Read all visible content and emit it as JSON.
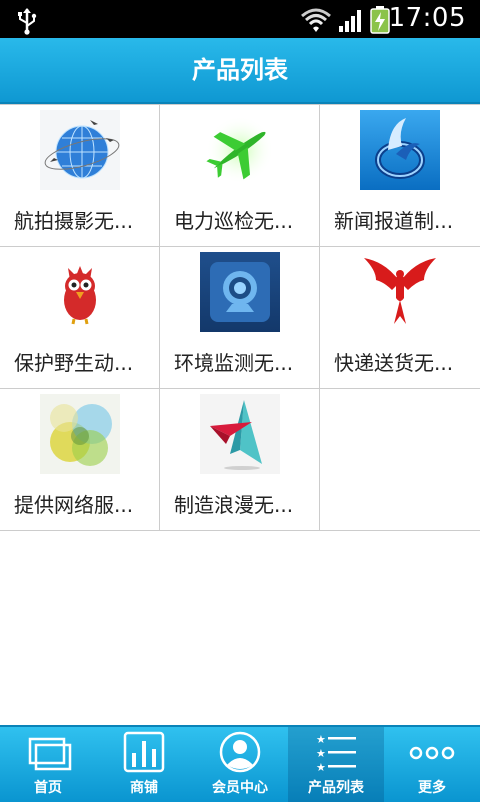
{
  "status_bar": {
    "time": "17:05",
    "icons": [
      "usb-icon",
      "wifi-icon",
      "signal-icon",
      "battery-charging-icon"
    ]
  },
  "header": {
    "title": "产品列表",
    "color": "#1aa8df"
  },
  "products": [
    {
      "label": "航拍摄影无...",
      "image": "globe-planes-image"
    },
    {
      "label": "电力巡检无...",
      "image": "green-airplane-image"
    },
    {
      "label": "新闻报道制...",
      "image": "blue-swirl-logo-image"
    },
    {
      "label": "保护野生动...",
      "image": "red-bird-image"
    },
    {
      "label": "环境监测无...",
      "image": "webcam-image"
    },
    {
      "label": "快递送货无...",
      "image": "red-phoenix-image"
    },
    {
      "label": "提供网络服...",
      "image": "color-circles-image"
    },
    {
      "label": "制造浪漫无...",
      "image": "paper-plane-image"
    }
  ],
  "bottom_nav": {
    "items": [
      {
        "label": "首页",
        "icon": "home-pages-icon"
      },
      {
        "label": "商铺",
        "icon": "shop-bars-icon"
      },
      {
        "label": "会员中心",
        "icon": "member-avatar-icon"
      },
      {
        "label": "产品列表",
        "icon": "star-list-icon",
        "active": true
      },
      {
        "label": "更多",
        "icon": "more-dots-icon"
      }
    ]
  }
}
